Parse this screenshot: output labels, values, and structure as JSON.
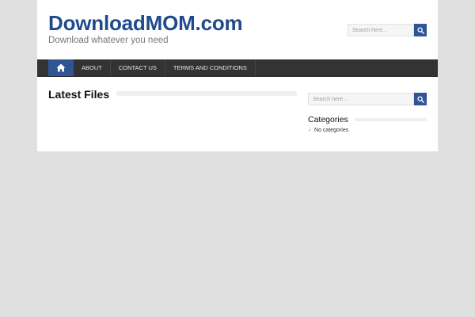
{
  "site": {
    "title": "DownloadMOM.com",
    "tagline": "Download whatever you need"
  },
  "header_search": {
    "placeholder": "Search here...",
    "icon": "search-icon"
  },
  "nav": {
    "home_icon": "home-icon",
    "items": [
      {
        "label": "ABOUT"
      },
      {
        "label": "CONTACT US"
      },
      {
        "label": "TERMS AND CONDITIONS"
      }
    ]
  },
  "main": {
    "section_title": "Latest Files"
  },
  "sidebar": {
    "search_placeholder": "Search here...",
    "categories_title": "Categories",
    "categories_empty": "No categories"
  },
  "colors": {
    "brand": "#1f4a8c",
    "accent": "#2f5596",
    "nav_bg": "#333333",
    "background": "#e0e0e0"
  }
}
